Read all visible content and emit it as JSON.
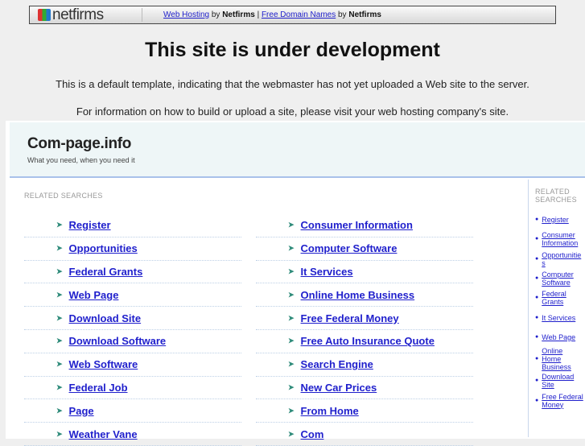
{
  "topbar": {
    "logo": "netfirms",
    "link1": "Web Hosting",
    "by1": "by",
    "brand1": "Netfirms",
    "sep": "|",
    "link2": "Free Domain Names",
    "by2": "by",
    "brand2": "Netfirms"
  },
  "heading": "This site is under development",
  "line1": "This is a default template, indicating that the webmaster has not yet uploaded a Web site to the server.",
  "line2": "For information on how to build or upload a site, please visit your web hosting company's site.",
  "site": {
    "name": "Com-page.info",
    "tagline": "What you need, when you need it"
  },
  "related_label": "RELATED SEARCHES",
  "col1": [
    "Register",
    "Opportunities",
    "Federal Grants",
    "Web Page",
    "Download Site",
    "Download Software",
    "Web Software",
    "Federal Job",
    "Page",
    "Weather Vane"
  ],
  "col2": [
    "Consumer Information",
    "Computer Software",
    "It Services",
    "Online Home Business",
    "Free Federal Money",
    "Free Auto Insurance Quote",
    "Search Engine",
    "New Car Prices",
    "From Home",
    "Com"
  ],
  "right_label": "RELATED SEARCHES",
  "right": [
    "Register",
    "Consumer Information",
    "Opportunities",
    "Computer Software",
    "Federal Grants",
    "It Services",
    "Web Page",
    "Online Home Business",
    "Download Site",
    "Free Federal Money"
  ]
}
